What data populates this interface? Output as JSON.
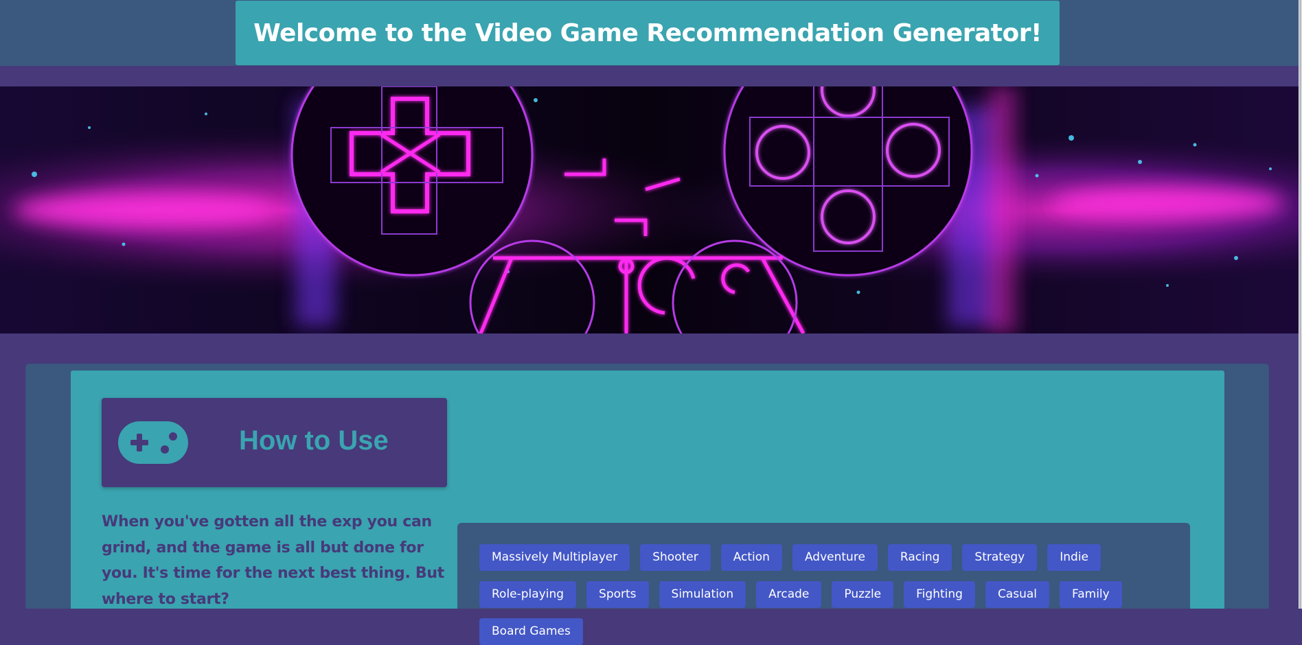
{
  "header": {
    "title": "Welcome to the Video Game Recommendation Generator!"
  },
  "banner": {
    "icon": "neon-game-controller-banner"
  },
  "how_to_use": {
    "title": "How to Use",
    "icon": "gamepad-icon",
    "intro": "When you've gotten all the exp you can grind, and the game is all but done for you. It's time for the next best thing. But where to start?"
  },
  "genres": [
    "Massively Multiplayer",
    "Shooter",
    "Action",
    "Adventure",
    "Racing",
    "Strategy",
    "Indie",
    "Role-playing",
    "Sports",
    "Simulation",
    "Arcade",
    "Puzzle",
    "Fighting",
    "Casual",
    "Family",
    "Board Games"
  ],
  "colors": {
    "page_background": "#47397a",
    "header_bar": "#3b587e",
    "teal": "#3aa4b0",
    "purple": "#47397a",
    "genre_button": "#4357c6",
    "genre_panel": "#3b587e",
    "title_text": "#ffffff"
  }
}
